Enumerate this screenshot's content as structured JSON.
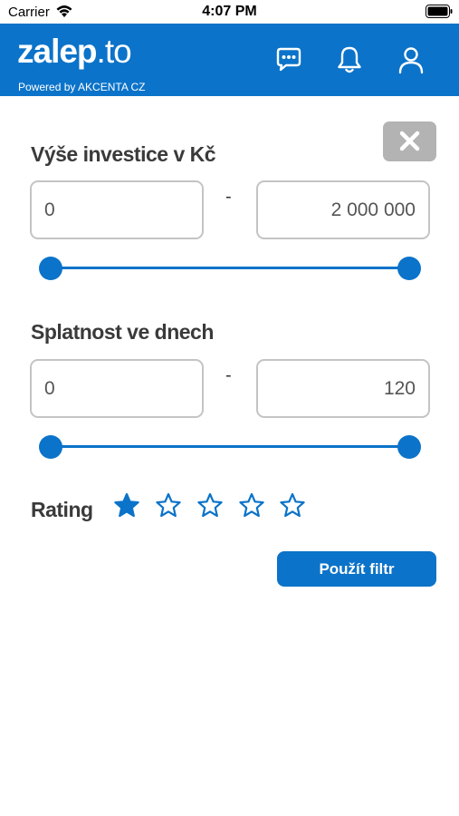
{
  "status_bar": {
    "carrier": "Carrier",
    "time": "4:07 PM"
  },
  "header": {
    "logo_main": "zalep",
    "logo_dot": ".",
    "logo_end": "to",
    "powered_by": "Powered by AKCENTA CZ",
    "icons": [
      "chat-icon",
      "bell-icon",
      "user-icon"
    ]
  },
  "filter": {
    "close_icon": "close-icon",
    "investment": {
      "title": "Výše investice v Kč",
      "min_value": "0",
      "max_value": "2 000 000",
      "separator": "-",
      "slider_min_fraction": 0,
      "slider_max_fraction": 1
    },
    "maturity": {
      "title": "Splatnost ve dnech",
      "min_value": "0",
      "max_value": "120",
      "separator": "-",
      "slider_min_fraction": 0,
      "slider_max_fraction": 1
    },
    "rating": {
      "label": "Rating",
      "value": 1,
      "max": 5
    },
    "apply_label": "Použít filtr"
  },
  "colors": {
    "brand_blue": "#0b73c9",
    "close_bg": "#b3b3b3"
  }
}
